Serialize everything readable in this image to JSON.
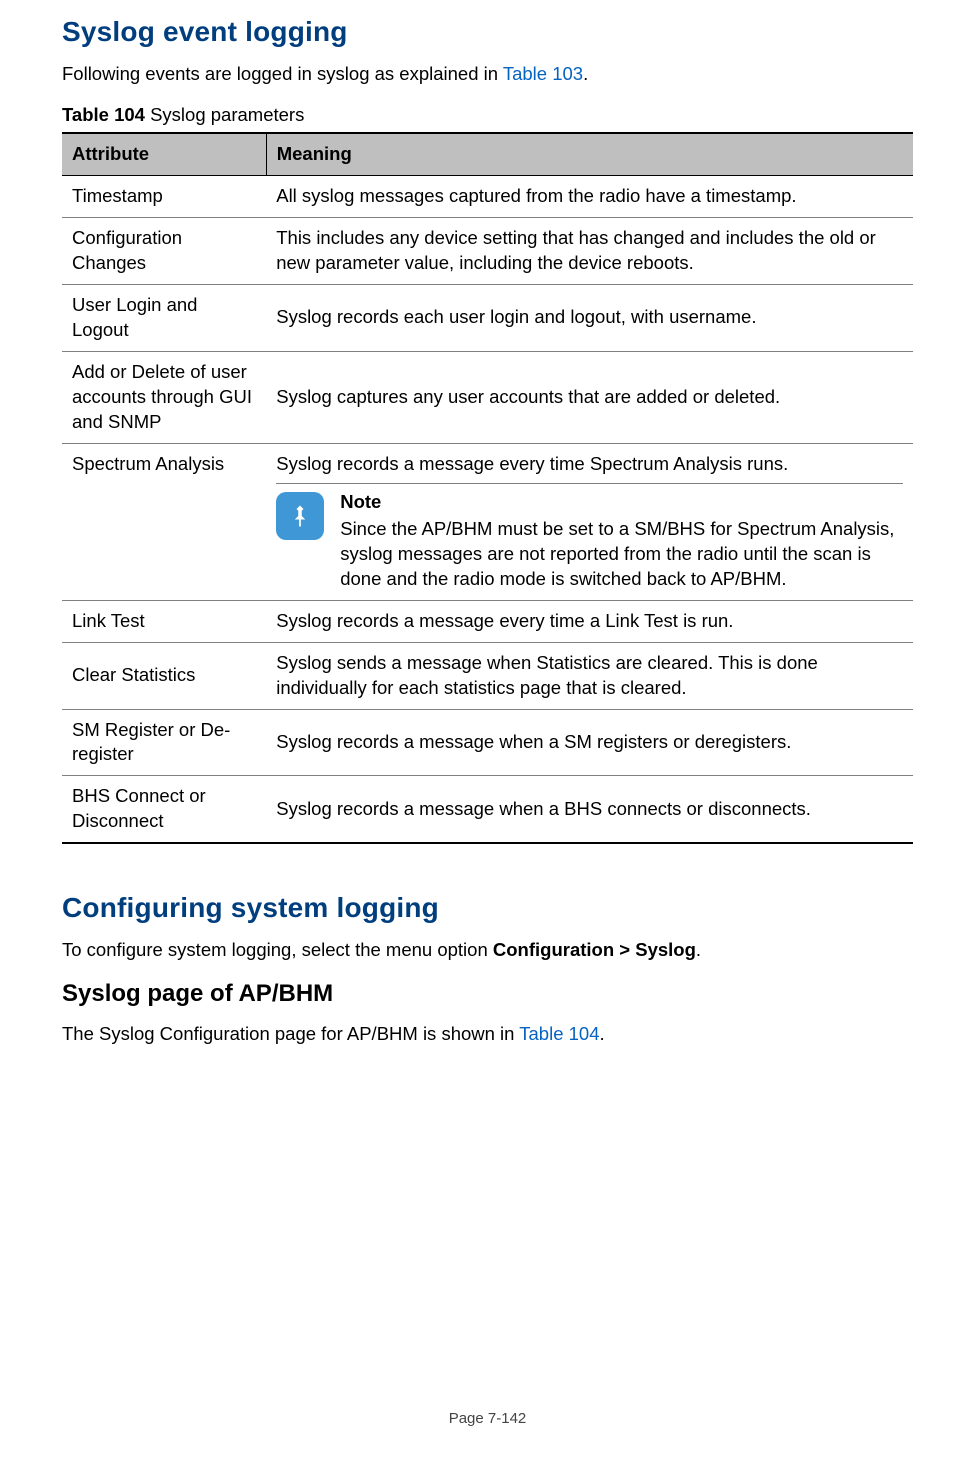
{
  "headings": {
    "h1a": "Syslog event logging",
    "h1b": "Configuring system logging",
    "h2": "Syslog page of AP/BHM"
  },
  "intro": {
    "text_before_link": "Following events are logged in syslog as explained in ",
    "link": "Table 103",
    "text_after_link": "."
  },
  "caption": {
    "label": "Table 104",
    "title": " Syslog parameters"
  },
  "table": {
    "headers": {
      "attr": "Attribute",
      "meaning": "Meaning"
    },
    "rows": [
      {
        "attr": "Timestamp",
        "meaning": "All syslog messages captured from the radio have a timestamp."
      },
      {
        "attr": "Configuration Changes",
        "meaning": "This includes any device setting that has changed and includes the old or new parameter value, including the device reboots."
      },
      {
        "attr": "User Login and Logout",
        "meaning": "Syslog records each user login and logout, with username."
      },
      {
        "attr": "Add or Delete of user accounts through GUI and SNMP",
        "meaning": "Syslog captures any user accounts that are added or deleted."
      },
      {
        "attr": "Spectrum Analysis",
        "meaning": "Syslog records a message every time Spectrum Analysis runs.",
        "note_title": "Note",
        "note_body": "Since the AP/BHM must be set to a SM/BHS for Spectrum Analysis, syslog messages are not reported from the radio until the scan is done and the radio mode is switched back to AP/BHM."
      },
      {
        "attr": "Link Test",
        "meaning": "Syslog records a message every time a Link Test is run."
      },
      {
        "attr": "Clear Statistics",
        "meaning": "Syslog sends a message when Statistics are cleared. This is done individually for each statistics page that is cleared."
      },
      {
        "attr": "SM Register or De-register",
        "meaning": "Syslog records a message when a SM registers or deregisters."
      },
      {
        "attr": "BHS Connect or Disconnect",
        "meaning": "Syslog records a message when a BHS connects or disconnects."
      }
    ]
  },
  "config_intro": {
    "before_bold": "To configure system logging, select the menu option ",
    "bold": "Configuration > Syslog",
    "after_bold": "."
  },
  "syslog_page_intro": {
    "before_link": "The Syslog Configuration page for AP/BHM is shown in ",
    "link": "Table 104",
    "after_link": "."
  },
  "footer": {
    "page": "Page 7-142"
  }
}
